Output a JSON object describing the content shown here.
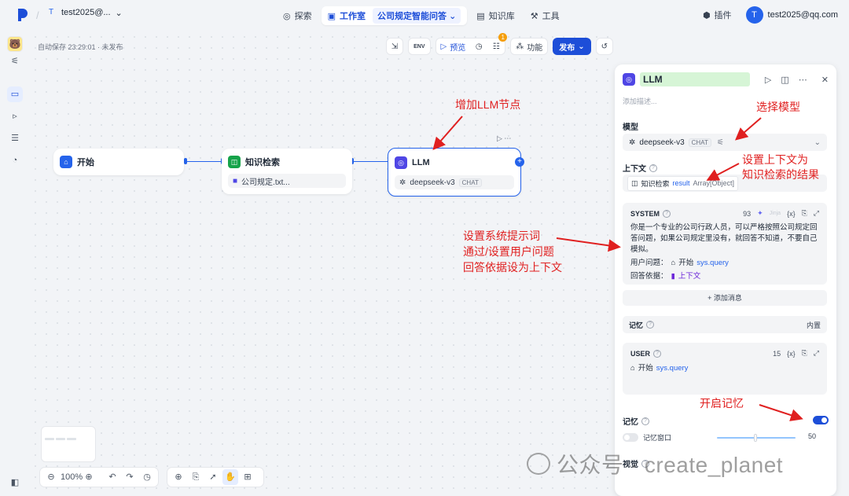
{
  "topbar": {
    "workspace": "test2025@...",
    "workspace_badge": "T",
    "tabs": [
      {
        "label": "探索",
        "icon": "explore-icon"
      },
      {
        "label": "工作室",
        "icon": "robot-icon",
        "sub": "公司规定智能问答"
      },
      {
        "label": "知识库",
        "icon": "book-icon"
      },
      {
        "label": "工具",
        "icon": "tool-icon"
      }
    ],
    "plugin": "插件",
    "avatar": "T",
    "user_email": "test2025@qq.com"
  },
  "canvas": {
    "autosave": "自动保存 23:29:01 · 未发布",
    "toolbar": {
      "preview": "预览",
      "feature": "功能",
      "publish": "发布",
      "env": "ENV",
      "notif_count": "1"
    },
    "zoom": "100%"
  },
  "nodes": {
    "start": {
      "title": "开始"
    },
    "knowledge": {
      "title": "知识检索",
      "file": "公司规定.txt..."
    },
    "llm": {
      "title": "LLM",
      "model": "deepseek-v3",
      "chip": "CHAT"
    }
  },
  "annotations": {
    "add_llm": "增加LLM节点",
    "select_model": "选择模型",
    "context_1": "设置上下文为",
    "context_2": "知识检索的结果",
    "system_1": "设置系统提示词",
    "system_2": "通过/设置用户问题",
    "system_3": "回答依据设为上下文",
    "memory": "开启记忆"
  },
  "panel": {
    "title": "LLM",
    "desc": "添加描述...",
    "model_label": "模型",
    "model": "deepseek-v3",
    "model_chip": "CHAT",
    "context_label": "上下文",
    "context_node": "知识检索",
    "context_var": "result",
    "context_type": "Array[Object]",
    "system": {
      "label": "SYSTEM",
      "count": "93",
      "jinja": "Jinja",
      "text": "你是一个专业的公司行政人员，可以严格按照公司规定回答问题，如果公司规定里没有，就回答不知道，不要自己模拟。",
      "q_label": "用户问题：",
      "q_node": "开始",
      "q_var": "sys.query",
      "ans_label": "回答依据：",
      "ans_var": "上下文"
    },
    "add_msg": "+ 添加消息",
    "memory_label": "记忆",
    "memory_builtin": "内置",
    "user": {
      "label": "USER",
      "count": "15",
      "node": "开始",
      "var": "sys.query"
    },
    "memory2_label": "记忆",
    "memory_window": "记忆窗口",
    "memory_window_value": "50",
    "vision_label": "视觉"
  },
  "watermark": "公众号 · create_planet"
}
